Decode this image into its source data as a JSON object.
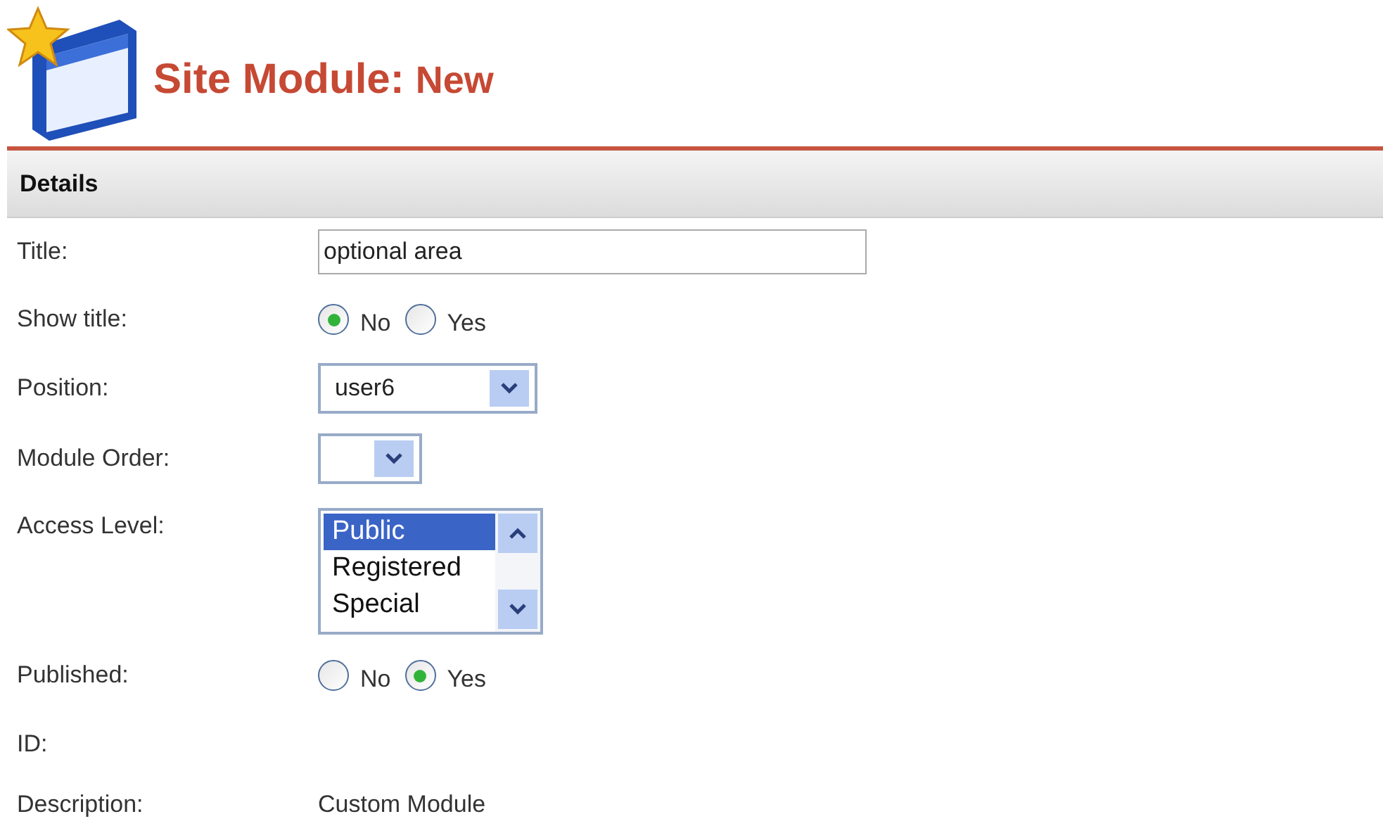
{
  "header": {
    "title": "Site Module:",
    "subtitle": "New"
  },
  "section": {
    "title": "Details"
  },
  "fields": [
    {
      "kind": "text",
      "label": "Title:",
      "value": "optional area"
    },
    {
      "kind": "radio",
      "label": "Show title:",
      "options": [
        {
          "label": "No",
          "selected": true
        },
        {
          "label": "Yes",
          "selected": false
        }
      ]
    },
    {
      "kind": "select",
      "label": "Position:",
      "value": "user6"
    },
    {
      "kind": "select",
      "label": "Module Order:"
    },
    {
      "kind": "listbox",
      "label": "Access Level:",
      "options": [
        {
          "label": "Public",
          "selected": true
        },
        {
          "label": "Registered",
          "selected": false
        },
        {
          "label": "Special",
          "selected": false
        }
      ]
    },
    {
      "kind": "radio",
      "label": "Published:",
      "options": [
        {
          "label": "No",
          "selected": false
        },
        {
          "label": "Yes",
          "selected": true
        }
      ]
    },
    {
      "kind": "static",
      "label": "ID:"
    },
    {
      "kind": "static",
      "label": "Description:",
      "value": "Custom Module"
    }
  ]
}
